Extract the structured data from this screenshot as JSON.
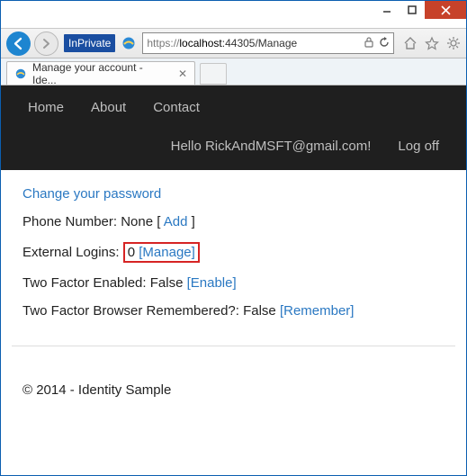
{
  "window": {
    "inprivate_label": "InPrivate",
    "url_protocol": "https://",
    "url_host": "localhost",
    "url_path": ":44305/Manage",
    "tab_title": "Manage your account - Ide..."
  },
  "navbar": {
    "links": [
      "Home",
      "About",
      "Contact"
    ],
    "greeting": "Hello RickAndMSFT@gmail.com!",
    "logoff": "Log off"
  },
  "content": {
    "change_password": "Change your password",
    "phone_label": "Phone Number: None [ ",
    "phone_add": "Add",
    "phone_close": " ]",
    "ext_logins_label": "External Logins: ",
    "ext_logins_count": "0 ",
    "ext_logins_manage": "[Manage]",
    "twofactor_label": "Two Factor Enabled: False ",
    "twofactor_enable": "[Enable]",
    "remember_label": "Two Factor Browser Remembered?: False ",
    "remember_link": "[Remember]"
  },
  "footer": {
    "text": "© 2014 - Identity Sample"
  }
}
